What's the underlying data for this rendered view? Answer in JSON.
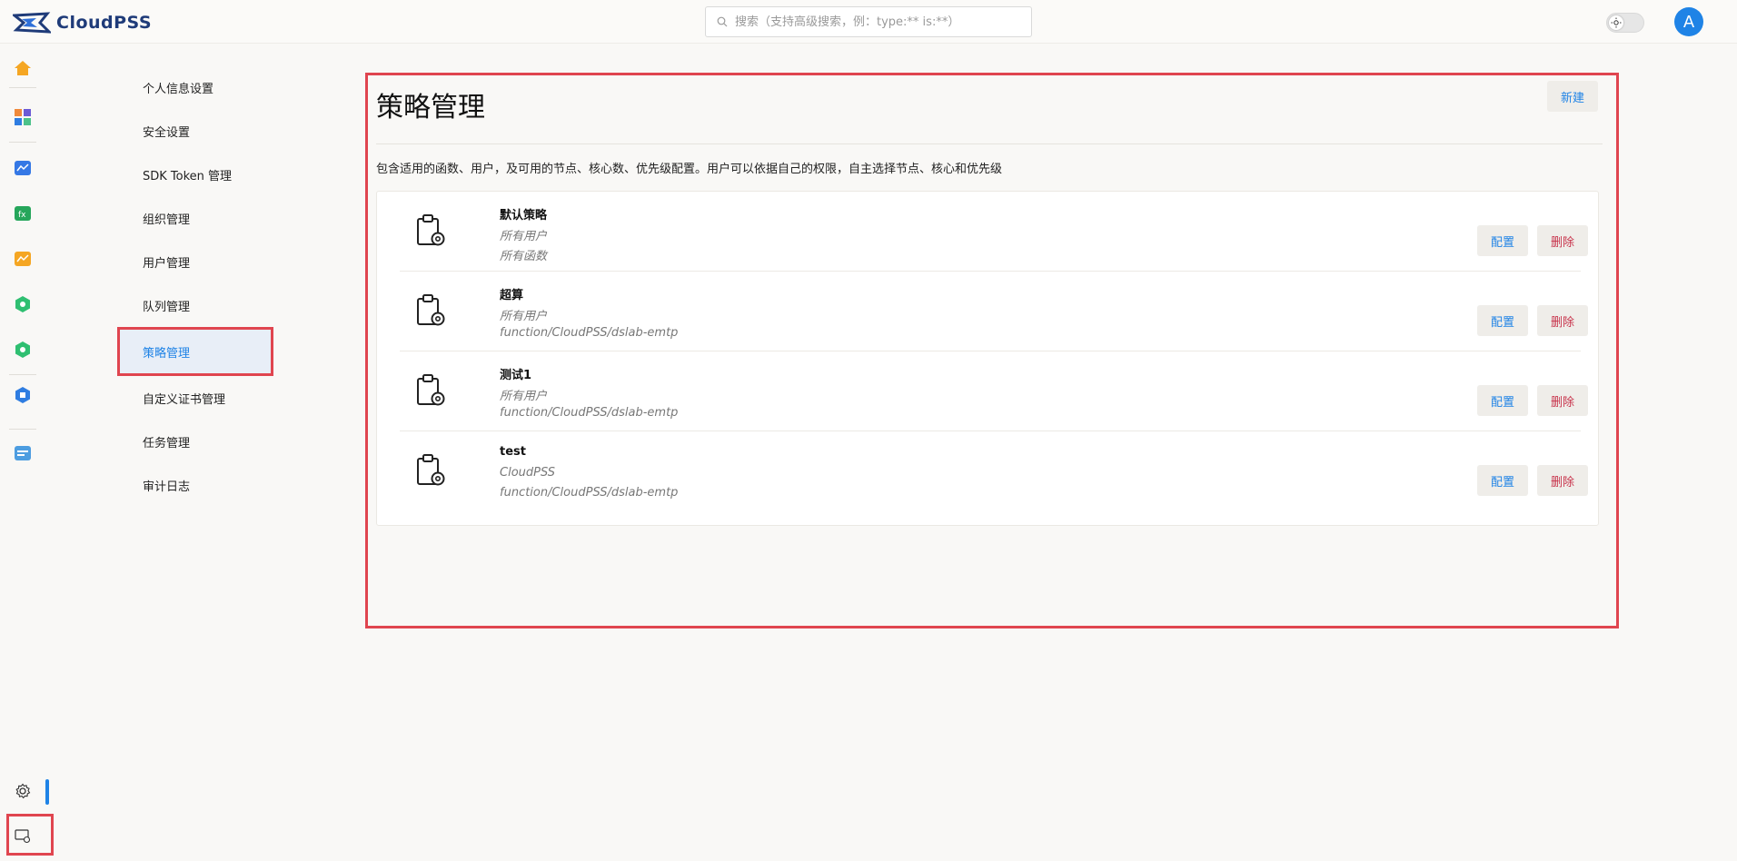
{
  "app": {
    "logo_text": "CloudPSS",
    "avatar_letter": "A"
  },
  "search": {
    "placeholder": "搜索（支持高级搜索，例：type:** is:**）"
  },
  "nav": {
    "items": [
      "个人信息设置",
      "安全设置",
      "SDK Token 管理",
      "组织管理",
      "用户管理",
      "队列管理",
      "策略管理",
      "自定义证书管理",
      "任务管理",
      "审计日志"
    ],
    "active_index": 6
  },
  "main": {
    "title": "策略管理",
    "new_button": "新建",
    "description": "包含适用的函数、用户，及可用的节点、核心数、优先级配置。用户可以依据自己的权限，自主选择节点、核心和优先级",
    "config_label": "配置",
    "delete_label": "删除",
    "policies": [
      {
        "name": "默认策略",
        "users": "所有用户",
        "functions": "所有函数"
      },
      {
        "name": "超算",
        "users": "所有用户",
        "functions": "function/CloudPSS/dslab-emtp"
      },
      {
        "name": "测试1",
        "users": "所有用户",
        "functions": "function/CloudPSS/dslab-emtp"
      },
      {
        "name": "test",
        "users": "CloudPSS",
        "functions": "function/CloudPSS/dslab-emtp"
      }
    ]
  },
  "colors": {
    "accent": "#1f83e6",
    "danger": "#c8324a",
    "highlight_border": "#e0454f"
  }
}
